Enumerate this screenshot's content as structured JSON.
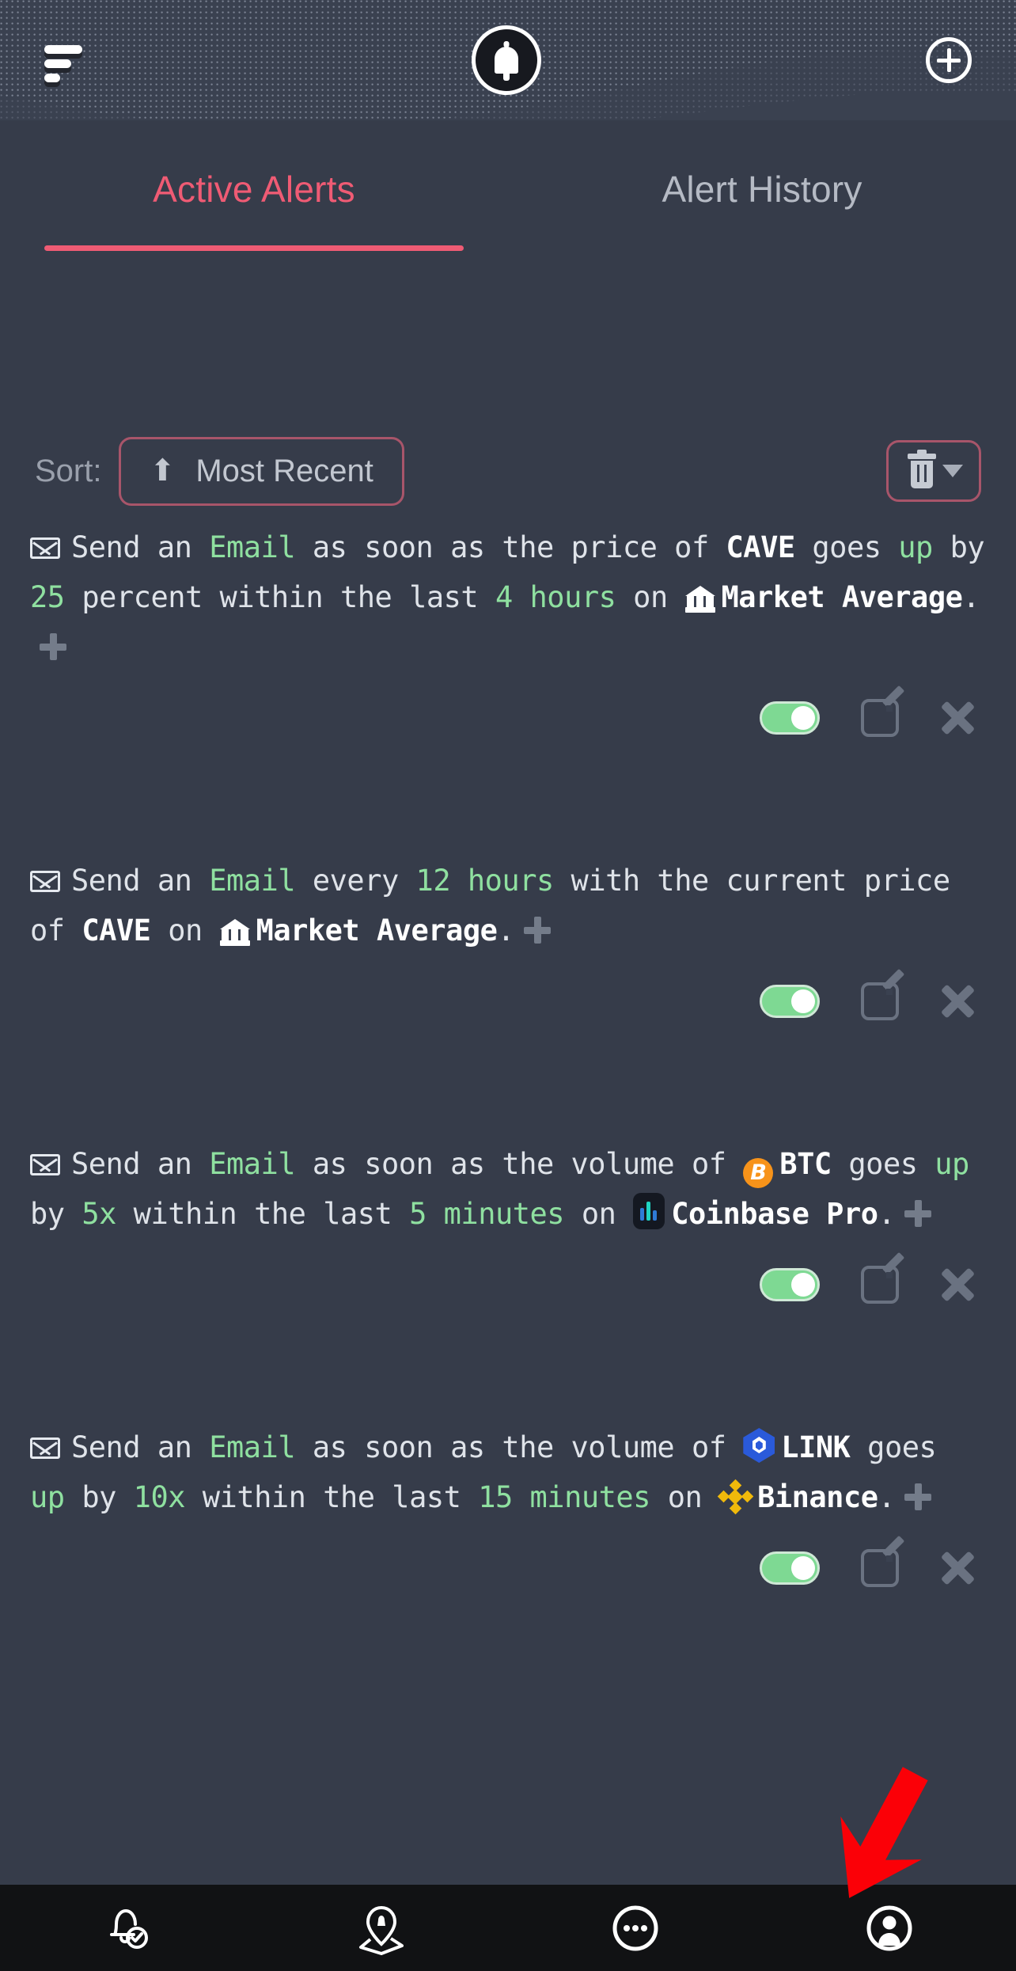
{
  "header": {
    "menu_icon": "filter-menu-icon",
    "logo_icon": "bell-logo-icon",
    "add_icon": "plus-circle-icon"
  },
  "tabs": [
    {
      "label": "Active Alerts",
      "active": true
    },
    {
      "label": "Alert History",
      "active": false
    }
  ],
  "sort": {
    "label": "Sort:",
    "arrow": "⬆",
    "value": "Most Recent",
    "delete_icon": "trash-icon",
    "caret_icon": "chevron-down-icon"
  },
  "colors": {
    "accent_pink": "#ef5b74",
    "value_green": "#8fe0a0",
    "background": "#363c4a",
    "nav_background": "#111214",
    "toggle_on": "#7ed993",
    "arrow_red": "#fb0007"
  },
  "alerts": [
    {
      "channel_icon": "envelope-icon",
      "segments": [
        {
          "t": "Send an ",
          "s": "plain"
        },
        {
          "t": "Email",
          "s": "green"
        },
        {
          "t": " as soon as the price of ",
          "s": "plain"
        },
        {
          "t": "CAVE",
          "s": "white"
        },
        {
          "t": " goes ",
          "s": "plain"
        },
        {
          "t": "up",
          "s": "green"
        },
        {
          "t": " by ",
          "s": "plain"
        },
        {
          "t": "25",
          "s": "green"
        },
        {
          "t": " percent within the last ",
          "s": "plain"
        },
        {
          "t": "4 hours",
          "s": "green"
        },
        {
          "t": " on ",
          "s": "plain"
        },
        {
          "t": "glyph:bank",
          "s": "glyph"
        },
        {
          "t": "Market Average",
          "s": "white"
        },
        {
          "t": ".",
          "s": "plain"
        },
        {
          "t": "glyph:plus",
          "s": "glyph"
        }
      ],
      "enabled": true,
      "edit_icon": "edit-icon",
      "delete_icon": "close-icon"
    },
    {
      "channel_icon": "envelope-icon",
      "segments": [
        {
          "t": "Send an ",
          "s": "plain"
        },
        {
          "t": "Email",
          "s": "green"
        },
        {
          "t": " every ",
          "s": "plain"
        },
        {
          "t": "12 hours",
          "s": "green"
        },
        {
          "t": " with the current price of ",
          "s": "plain"
        },
        {
          "t": "CAVE",
          "s": "white"
        },
        {
          "t": " on ",
          "s": "plain"
        },
        {
          "t": "glyph:bank",
          "s": "glyph"
        },
        {
          "t": "Market Average",
          "s": "white"
        },
        {
          "t": ".",
          "s": "plain"
        },
        {
          "t": "glyph:plus",
          "s": "glyph"
        }
      ],
      "enabled": true,
      "edit_icon": "edit-icon",
      "delete_icon": "close-icon"
    },
    {
      "channel_icon": "envelope-icon",
      "segments": [
        {
          "t": "Send an ",
          "s": "plain"
        },
        {
          "t": "Email",
          "s": "green"
        },
        {
          "t": " as soon as the volume of ",
          "s": "plain"
        },
        {
          "t": "glyph:btc",
          "s": "glyph"
        },
        {
          "t": "BTC",
          "s": "white"
        },
        {
          "t": " goes ",
          "s": "plain"
        },
        {
          "t": "up",
          "s": "green"
        },
        {
          "t": " by ",
          "s": "plain"
        },
        {
          "t": "5x",
          "s": "green"
        },
        {
          "t": " within the last ",
          "s": "plain"
        },
        {
          "t": "5 minutes",
          "s": "green"
        },
        {
          "t": " on ",
          "s": "plain"
        },
        {
          "t": "glyph:cbp",
          "s": "glyph"
        },
        {
          "t": "Coinbase Pro",
          "s": "white"
        },
        {
          "t": ".",
          "s": "plain"
        },
        {
          "t": "glyph:plus",
          "s": "glyph"
        }
      ],
      "enabled": true,
      "edit_icon": "edit-icon",
      "delete_icon": "close-icon"
    },
    {
      "channel_icon": "envelope-icon",
      "segments": [
        {
          "t": "Send an ",
          "s": "plain"
        },
        {
          "t": "Email",
          "s": "green"
        },
        {
          "t": " as soon as the volume of ",
          "s": "plain"
        },
        {
          "t": "glyph:link",
          "s": "glyph"
        },
        {
          "t": "LINK",
          "s": "white"
        },
        {
          "t": " goes ",
          "s": "plain"
        },
        {
          "t": "up",
          "s": "green"
        },
        {
          "t": " by ",
          "s": "plain"
        },
        {
          "t": "10x",
          "s": "green"
        },
        {
          "t": " within the last ",
          "s": "plain"
        },
        {
          "t": "15 minutes",
          "s": "green"
        },
        {
          "t": " on ",
          "s": "plain"
        },
        {
          "t": "glyph:bnb",
          "s": "glyph"
        },
        {
          "t": "Binance",
          "s": "white"
        },
        {
          "t": ".",
          "s": "plain"
        },
        {
          "t": "glyph:plus",
          "s": "glyph"
        }
      ],
      "enabled": true,
      "edit_icon": "edit-icon",
      "delete_icon": "close-icon"
    }
  ],
  "annotation": {
    "arrow_icon": "red-pointer-arrow",
    "points_to": "nav-item-profile"
  },
  "bottom_nav": [
    {
      "icon": "bell-check-icon",
      "active": false
    },
    {
      "icon": "alert-pin-icon",
      "active": false
    },
    {
      "icon": "more-dots-icon",
      "active": false
    },
    {
      "icon": "profile-icon",
      "active": true
    }
  ]
}
